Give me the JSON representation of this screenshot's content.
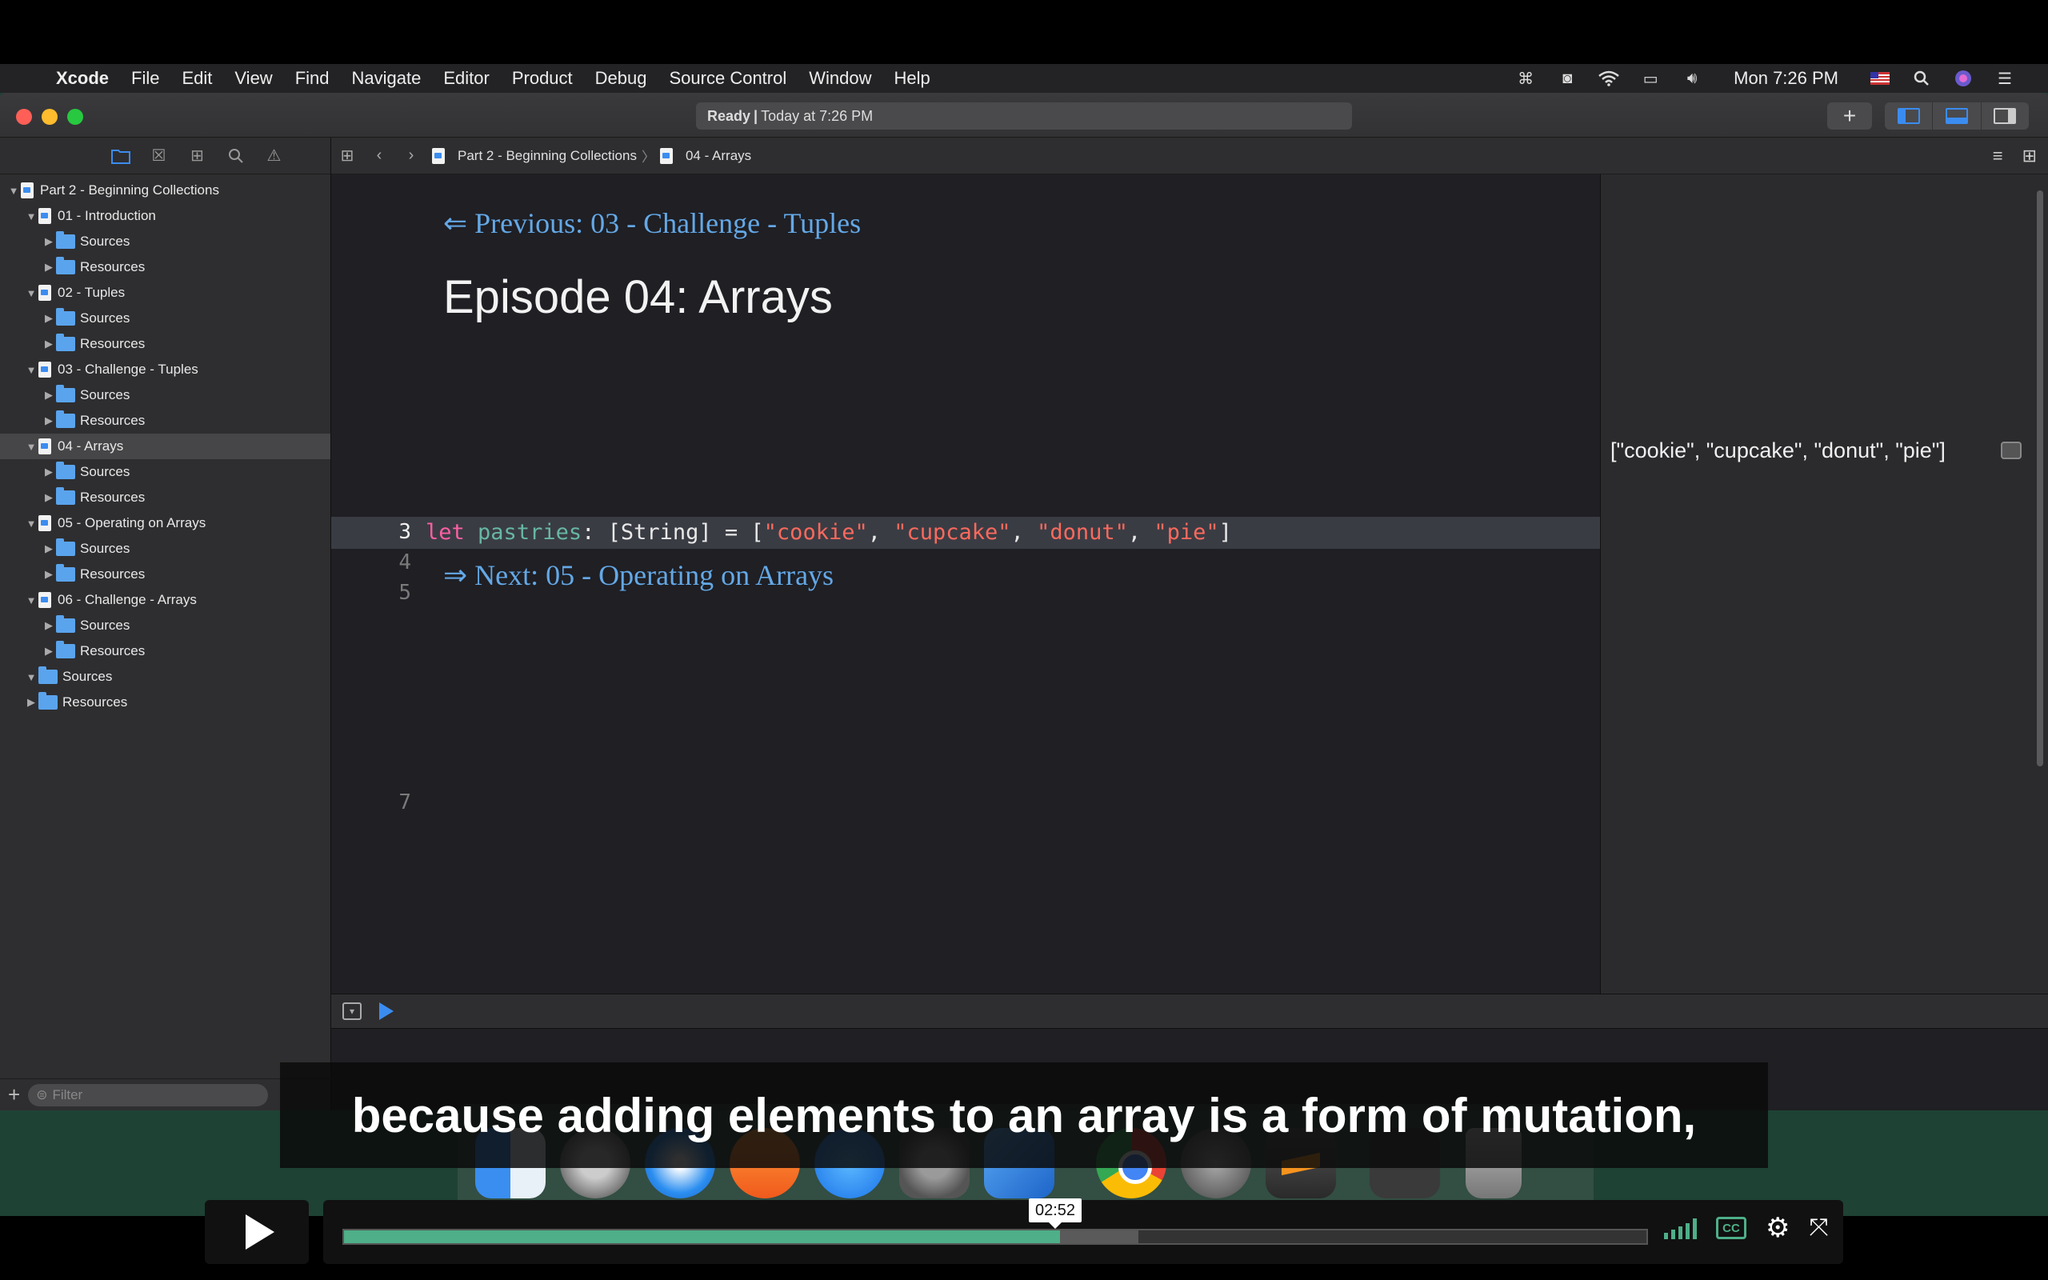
{
  "menubar": {
    "app_name": "Xcode",
    "menus": [
      "File",
      "Edit",
      "View",
      "Find",
      "Navigate",
      "Editor",
      "Product",
      "Debug",
      "Source Control",
      "Window",
      "Help"
    ],
    "clock": "Mon 7:26 PM"
  },
  "window": {
    "activity_status": "Ready",
    "activity_separator": "|",
    "activity_time": "Today at 7:26 PM",
    "add_button": "+"
  },
  "navigator": {
    "tree": [
      {
        "label": "Part 2 - Beginning Collections",
        "kind": "file",
        "level": 0,
        "expanded": true
      },
      {
        "label": "01 - Introduction",
        "kind": "file",
        "level": 1,
        "expanded": true
      },
      {
        "label": "Sources",
        "kind": "folder",
        "level": 2
      },
      {
        "label": "Resources",
        "kind": "folder",
        "level": 2
      },
      {
        "label": "02 - Tuples",
        "kind": "file",
        "level": 1,
        "expanded": true
      },
      {
        "label": "Sources",
        "kind": "folder",
        "level": 2
      },
      {
        "label": "Resources",
        "kind": "folder",
        "level": 2
      },
      {
        "label": "03 - Challenge - Tuples",
        "kind": "file",
        "level": 1,
        "expanded": true
      },
      {
        "label": "Sources",
        "kind": "folder",
        "level": 2
      },
      {
        "label": "Resources",
        "kind": "folder",
        "level": 2
      },
      {
        "label": "04 - Arrays",
        "kind": "file",
        "level": 1,
        "expanded": true,
        "selected": true
      },
      {
        "label": "Sources",
        "kind": "folder",
        "level": 2
      },
      {
        "label": "Resources",
        "kind": "folder",
        "level": 2
      },
      {
        "label": "05 - Operating on Arrays",
        "kind": "file",
        "level": 1,
        "expanded": true
      },
      {
        "label": "Sources",
        "kind": "folder",
        "level": 2
      },
      {
        "label": "Resources",
        "kind": "folder",
        "level": 2
      },
      {
        "label": "06 - Challenge - Arrays",
        "kind": "file",
        "level": 1,
        "expanded": true
      },
      {
        "label": "Sources",
        "kind": "folder",
        "level": 2
      },
      {
        "label": "Resources",
        "kind": "folder",
        "level": 2
      },
      {
        "label": "Sources",
        "kind": "folder",
        "level": 1,
        "expanded": true
      },
      {
        "label": "Resources",
        "kind": "folder",
        "level": 1,
        "expanded": false
      }
    ],
    "filter_placeholder": "Filter",
    "add_label": "+"
  },
  "jumpbar": {
    "crumb_project": "Part 2 - Beginning Collections",
    "crumb_separator": "〉",
    "crumb_page": "04 - Arrays"
  },
  "editor": {
    "prev_link": "⇐ Previous: 03 - Challenge - Tuples",
    "title": "Episode 04: Arrays",
    "next_link": "⇒ Next: 05 - Operating on Arrays",
    "line_numbers": {
      "l3": "3",
      "l4": "4",
      "l5": "5",
      "l7": "7"
    },
    "code": {
      "kw": "let",
      "name": "pastries",
      "type_part": ": [String] = [",
      "s1": "\"cookie\"",
      "s2": "\"cupcake\"",
      "s3": "\"donut\"",
      "s4": "\"pie\"",
      "comma": ", ",
      "close": "]"
    },
    "result": "[\"cookie\", \"cupcake\", \"donut\", \"pie\"]"
  },
  "caption": "because adding elements to an array is a form of mutation,",
  "player": {
    "time_tooltip": "02:52",
    "played_fraction": 0.55,
    "loaded_fraction": 0.61,
    "cc_label": "CC",
    "accent": "#4eaf88"
  }
}
